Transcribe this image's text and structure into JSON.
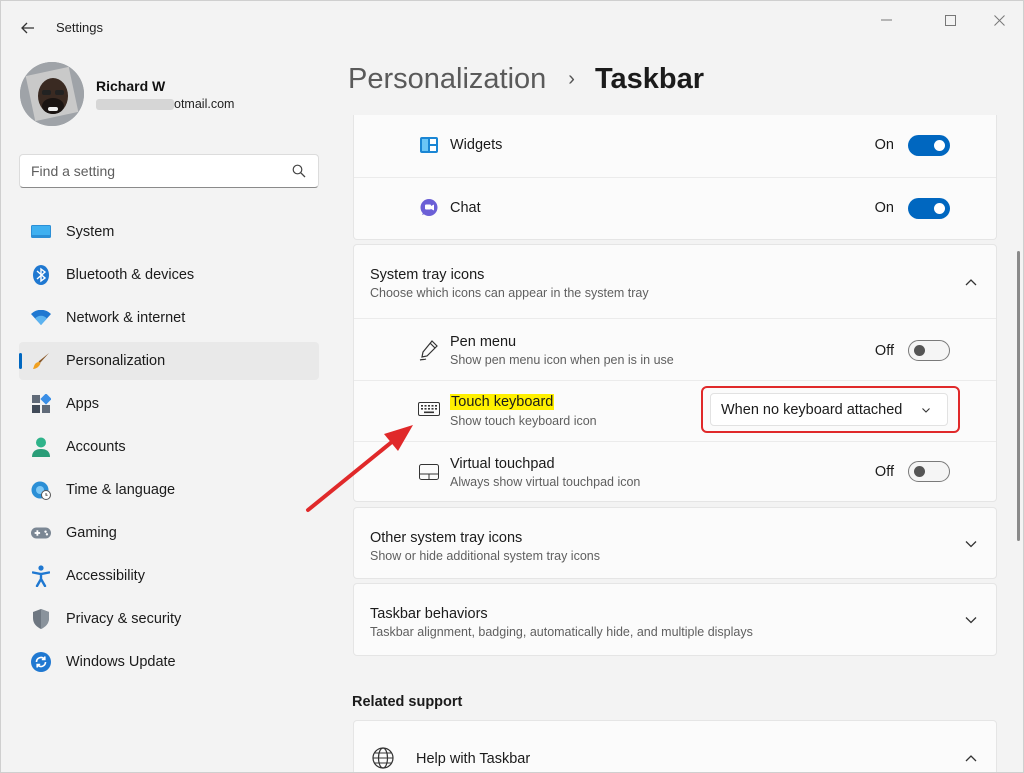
{
  "window": {
    "app_title": "Settings",
    "minimize": "—",
    "maximize": "□",
    "close": "✕"
  },
  "user": {
    "name": "Richard W",
    "email_visible": "otmail.com"
  },
  "search": {
    "placeholder": "Find a setting"
  },
  "sidebar": {
    "items": [
      {
        "label": "System",
        "icon": "system-icon"
      },
      {
        "label": "Bluetooth & devices",
        "icon": "bluetooth-icon"
      },
      {
        "label": "Network & internet",
        "icon": "wifi-icon"
      },
      {
        "label": "Personalization",
        "icon": "brush-icon",
        "active": true
      },
      {
        "label": "Apps",
        "icon": "apps-icon"
      },
      {
        "label": "Accounts",
        "icon": "accounts-icon"
      },
      {
        "label": "Time & language",
        "icon": "globe-clock-icon"
      },
      {
        "label": "Gaming",
        "icon": "gamepad-icon"
      },
      {
        "label": "Accessibility",
        "icon": "accessibility-icon"
      },
      {
        "label": "Privacy & security",
        "icon": "shield-icon"
      },
      {
        "label": "Windows Update",
        "icon": "update-icon"
      }
    ]
  },
  "header": {
    "crumb_parent": "Personalization",
    "separator": "›",
    "crumb_current": "Taskbar"
  },
  "taskbar_items": {
    "widgets": {
      "label": "Widgets",
      "state": "On"
    },
    "chat": {
      "label": "Chat",
      "state": "On"
    }
  },
  "system_tray": {
    "title": "System tray icons",
    "subtitle": "Choose which icons can appear in the system tray",
    "pen_menu": {
      "label": "Pen menu",
      "desc": "Show pen menu icon when pen is in use",
      "state": "Off"
    },
    "touch_keyboard": {
      "label": "Touch keyboard",
      "desc": "Show touch keyboard icon",
      "value": "When no keyboard attached"
    },
    "virtual_touchpad": {
      "label": "Virtual touchpad",
      "desc": "Always show virtual touchpad icon",
      "state": "Off"
    }
  },
  "other_tray": {
    "title": "Other system tray icons",
    "subtitle": "Show or hide additional system tray icons"
  },
  "behaviors": {
    "title": "Taskbar behaviors",
    "subtitle": "Taskbar alignment, badging, automatically hide, and multiple displays"
  },
  "related": {
    "heading": "Related support",
    "help_label": "Help with Taskbar"
  },
  "colors": {
    "accent": "#0067c0",
    "annotation_red": "#e0292a",
    "highlight_yellow": "#fff000"
  }
}
